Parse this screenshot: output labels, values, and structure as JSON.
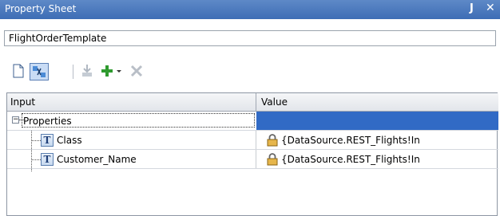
{
  "window": {
    "title": "Property Sheet",
    "pin_icon": "pin-icon",
    "close_icon": "close-icon"
  },
  "object_name": "FlightOrderTemplate",
  "toolbar": {
    "buttons": [
      {
        "icon": "new-document-icon"
      },
      {
        "icon": "map-icon",
        "selected": true
      },
      {
        "icon": "import-icon",
        "disabled": true
      },
      {
        "icon": "add-icon"
      },
      {
        "icon": "dropdown-arrow-icon"
      },
      {
        "icon": "delete-icon",
        "disabled": true
      }
    ]
  },
  "grid": {
    "columns": [
      "Input",
      "Value"
    ],
    "root": {
      "label": "Properties",
      "expanded": true,
      "selected_color": "#316ac5"
    },
    "rows": [
      {
        "name": "Class",
        "value": "{DataSource.REST_Flights!In",
        "locked": true
      },
      {
        "name": "Customer_Name",
        "value": "{DataSource.REST_Flights!In",
        "locked": true
      }
    ]
  },
  "colors": {
    "titlebar": "#4a78bd",
    "selection": "#316ac5"
  }
}
